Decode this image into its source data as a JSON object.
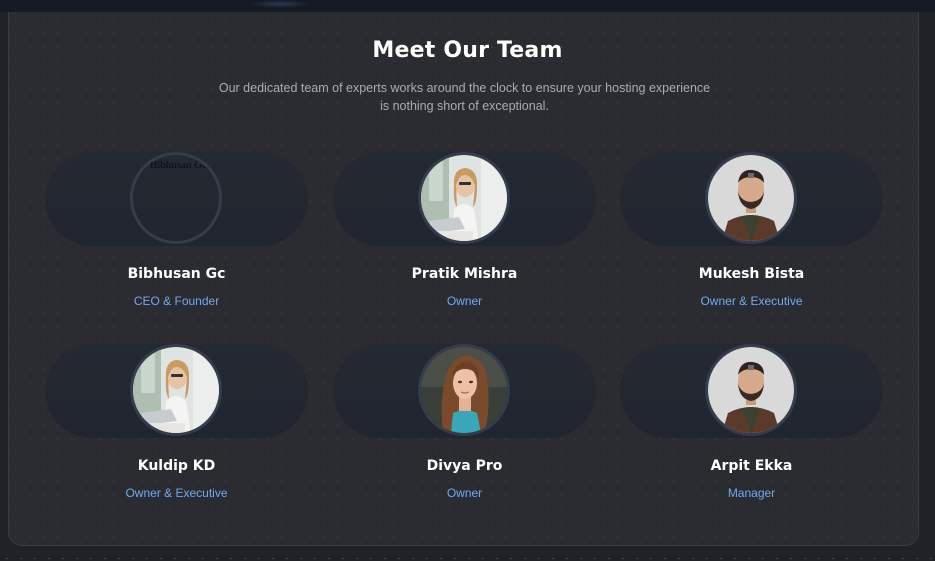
{
  "section": {
    "title": "Meet Our Team",
    "subtitle": "Our dedicated team of experts works around the clock to ensure your hosting experience is nothing short of exceptional."
  },
  "members": [
    {
      "name": "Bibhusan Gc",
      "role": "CEO & Founder",
      "photo_alt": "Bibhusan Gc",
      "photo": "broken-image"
    },
    {
      "name": "Pratik Mishra",
      "role": "Owner",
      "photo": "woman-office-laptop"
    },
    {
      "name": "Mukesh Bista",
      "role": "Owner & Executive",
      "photo": "man-beard-jacket"
    },
    {
      "name": "Kuldip KD",
      "role": "Owner & Executive",
      "photo": "woman-office-laptop"
    },
    {
      "name": "Divya Pro",
      "role": "Owner",
      "photo": "woman-long-hair"
    },
    {
      "name": "Arpit Ekka",
      "role": "Manager",
      "photo": "man-beard-jacket"
    }
  ],
  "colors": {
    "background": "#2a2c31",
    "accent_role": "#74a8ee",
    "avatar_border": "#353d4d"
  }
}
